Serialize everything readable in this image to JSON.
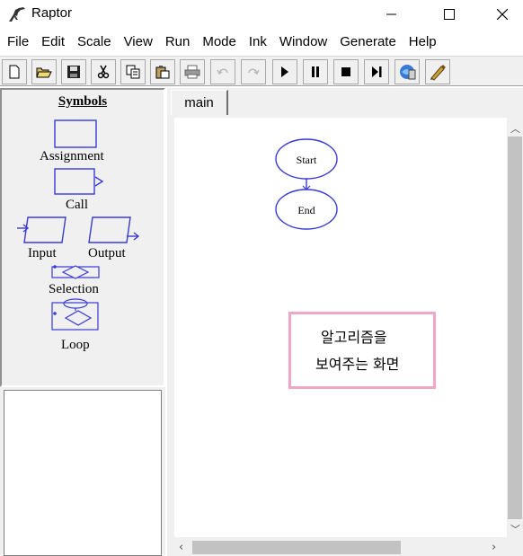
{
  "window": {
    "title": "Raptor"
  },
  "menu": {
    "items": [
      "File",
      "Edit",
      "Scale",
      "View",
      "Run",
      "Mode",
      "Ink",
      "Window",
      "Generate",
      "Help"
    ]
  },
  "toolbar": {
    "icons": [
      "new-file-icon",
      "open-folder-icon",
      "save-icon",
      "cut-icon",
      "copy-icon",
      "paste-icon",
      "print-icon",
      "undo-icon",
      "redo-icon",
      "play-icon",
      "pause-icon",
      "stop-icon",
      "step-icon",
      "test-server-icon",
      "pen-icon"
    ]
  },
  "symbols": {
    "heading": "Symbols",
    "assignment": "Assignment",
    "call": "Call",
    "input": "Input",
    "output": "Output",
    "selection": "Selection",
    "loop": "Loop"
  },
  "tabs": {
    "main": "main"
  },
  "flowchart": {
    "start": "Start",
    "end": "End"
  },
  "note": {
    "line1": "알고리즘을",
    "line2": "보여주는 화면"
  },
  "colors": {
    "shape_stroke": "#3a3ad6",
    "note_border": "#f2a6c6",
    "panel_bg": "#f0f0f0"
  }
}
